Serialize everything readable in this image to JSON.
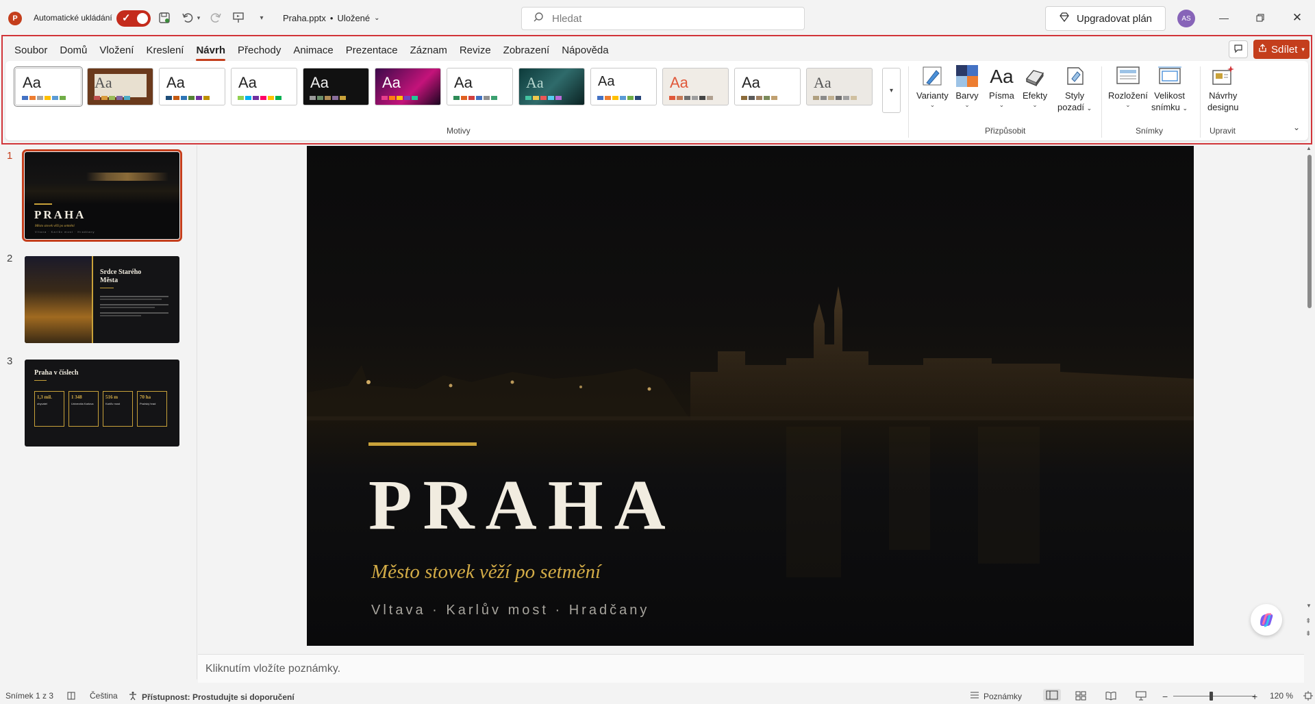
{
  "titlebar": {
    "app_icon": "powerpoint-icon",
    "autosave_label": "Automatické ukládání",
    "autosave_on": true,
    "filename": "Praha.pptx",
    "saved_status": "Uložené",
    "separator": "•",
    "search_placeholder": "Hledat",
    "upgrade_label": "Upgradovat plán",
    "avatar_initials": "AS"
  },
  "ribbon": {
    "tabs": [
      "Soubor",
      "Domů",
      "Vložení",
      "Kreslení",
      "Návrh",
      "Přechody",
      "Animace",
      "Prezentace",
      "Záznam",
      "Revize",
      "Zobrazení",
      "Nápověda"
    ],
    "active_tab": "Návrh",
    "share_label": "Sdílet",
    "themes_aa": [
      "Aa",
      "Aa",
      "Aa",
      "Aa",
      "Aa",
      "Aa",
      "Aa",
      "Aa",
      "Aa",
      "Aa",
      "Aa",
      "Aa"
    ],
    "groups": {
      "themes": "Motivy",
      "customize": "Přizpůsobit",
      "slides": "Snímky",
      "edit": "Upravit"
    },
    "buttons": {
      "variants": "Varianty",
      "colors": "Barvy",
      "fonts": "Písma",
      "fonts_icon_text": "Aa",
      "effects": "Efekty",
      "bg_styles_1": "Styly",
      "bg_styles_2": "pozadí",
      "layout": "Rozložení",
      "slide_size_1": "Velikost",
      "slide_size_2": "snímku",
      "designer_1": "Návrhy",
      "designer_2": "designu"
    }
  },
  "thumbnails": [
    {
      "number": "1",
      "title": "PRAHA",
      "subtitle": "Město stovek věží po setmění",
      "places": "Vltava · Karlův most · Hradčany"
    },
    {
      "number": "2",
      "title_line1": "Srdce Starého",
      "title_line2": "Města"
    },
    {
      "number": "3",
      "title": "Praha v číslech",
      "stats": [
        {
          "value": "1,3 mil.",
          "label": "obyvatel"
        },
        {
          "value": "1 348",
          "label": "Univerzita Karlova"
        },
        {
          "value": "516 m",
          "label": "Karlův most"
        },
        {
          "value": "70 ha",
          "label": "Pražský hrad"
        }
      ]
    }
  ],
  "slide": {
    "title": "PRAHA",
    "subtitle": "Město stovek věží po setmění",
    "places": "Vltava · Karlův most · Hradčany"
  },
  "notes_placeholder": "Kliknutím vložíte poznámky.",
  "statusbar": {
    "slide_counter": "Snímek 1 z 3",
    "language": "Čeština",
    "accessibility": "Přístupnost: Prostudujte si doporučení",
    "notes_label": "Poznámky",
    "zoom": "120 %",
    "zoom_fraction": 0.46
  },
  "colors": {
    "accent": "#c43e1c",
    "highlight_border": "#d13438",
    "slide_gold": "#c9a23a"
  }
}
